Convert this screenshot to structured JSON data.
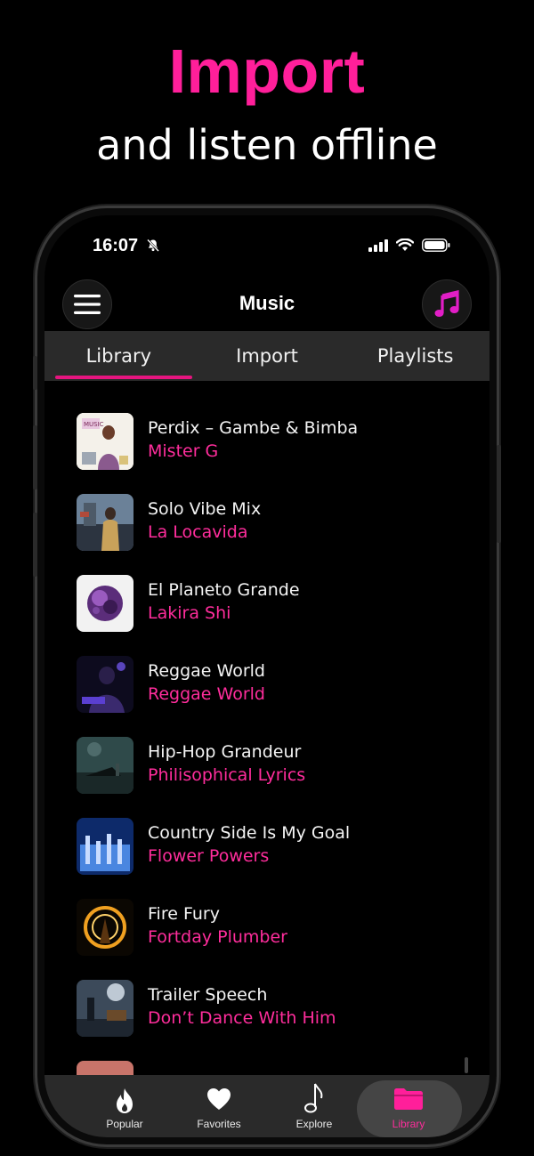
{
  "promo": {
    "headline": "Import",
    "subline": "and listen offline"
  },
  "status_bar": {
    "time": "16:07",
    "icons": [
      "bell-slash-icon",
      "cellular-icon",
      "wifi-icon",
      "battery-icon"
    ]
  },
  "header": {
    "title": "Music",
    "left_icon": "menu-icon",
    "right_icon": "music-note-icon"
  },
  "tabs": [
    {
      "label": "Library",
      "active": true
    },
    {
      "label": "Import",
      "active": false
    },
    {
      "label": "Playlists",
      "active": false
    }
  ],
  "songs": [
    {
      "title": "Perdix – Gambe & Bimba",
      "artist": "Mister G"
    },
    {
      "title": "Solo Vibe Mix",
      "artist": "La Locavida"
    },
    {
      "title": "El Planeto Grande",
      "artist": "Lakira Shi"
    },
    {
      "title": "Reggae World",
      "artist": "Reggae World"
    },
    {
      "title": "Hip-Hop Grandeur",
      "artist": "Philisophical Lyrics"
    },
    {
      "title": "Country Side Is My Goal",
      "artist": "Flower Powers"
    },
    {
      "title": "Fire Fury",
      "artist": "Fortday Plumber"
    },
    {
      "title": "Trailer Speech",
      "artist": "Don’t Dance With Him"
    }
  ],
  "bottom_nav": [
    {
      "label": "Popular",
      "icon": "flame-icon",
      "active": false
    },
    {
      "label": "Favorites",
      "icon": "heart-icon",
      "active": false
    },
    {
      "label": "Explore",
      "icon": "music-note-icon",
      "active": false
    },
    {
      "label": "Library",
      "icon": "folder-icon",
      "active": true
    }
  ],
  "colors": {
    "accent": "#ff1f9a",
    "background": "#000000",
    "tab_bar": "#2a2a2a"
  }
}
